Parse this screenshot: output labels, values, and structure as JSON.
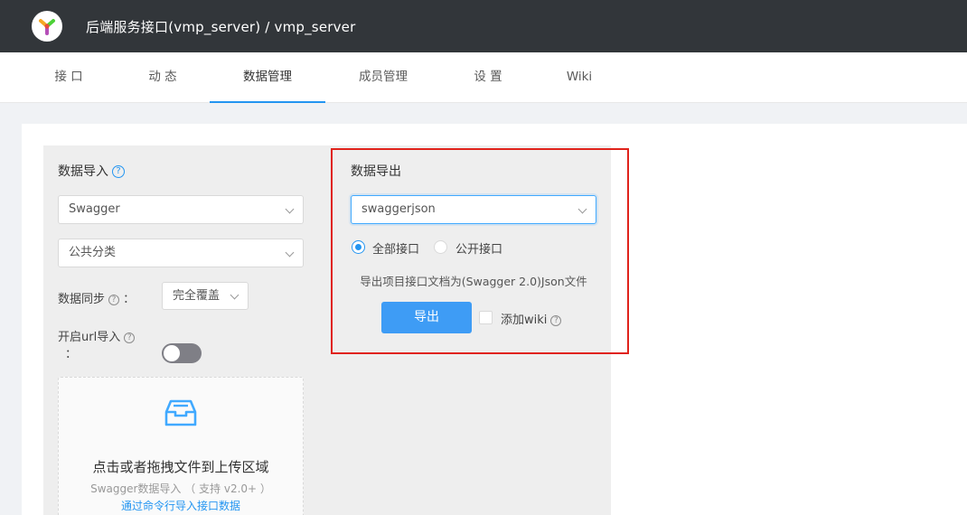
{
  "header": {
    "title": "后端服务接口(vmp_server)  /  vmp_server",
    "logo_icon": "yapi-logo-icon"
  },
  "tabs": [
    {
      "label": "接 口"
    },
    {
      "label": "动 态"
    },
    {
      "label": "数据管理"
    },
    {
      "label": "成员管理"
    },
    {
      "label": "设 置"
    },
    {
      "label": "Wiki"
    }
  ],
  "active_tab": "数据管理",
  "import_panel": {
    "title": "数据导入",
    "format_select": "Swagger",
    "category_select": "公共分类",
    "sync_label": "数据同步",
    "sync_colon": "：",
    "sync_select": "完全覆盖",
    "url_label": "开启url导入",
    "url_colon": "：",
    "url_toggle_on": false,
    "dropzone": {
      "text": "点击或者拖拽文件到上传区域",
      "hint": "Swagger数据导入 （ 支持 v2.0+ ）",
      "link": "通过命令行导入接口数据",
      "icon": "inbox-icon"
    }
  },
  "export_panel": {
    "title": "数据导出",
    "format_select": "swaggerjson",
    "radio_all": "全部接口",
    "radio_public": "公开接口",
    "selected_radio": "全部接口",
    "description": "导出项目接口文档为(Swagger 2.0)Json文件",
    "export_button": "导出",
    "wiki_checkbox": "添加wiki",
    "wiki_checked": false
  },
  "colors": {
    "header_bg": "#32363a",
    "accent": "#2395f1",
    "highlight_border": "#e0231b"
  }
}
